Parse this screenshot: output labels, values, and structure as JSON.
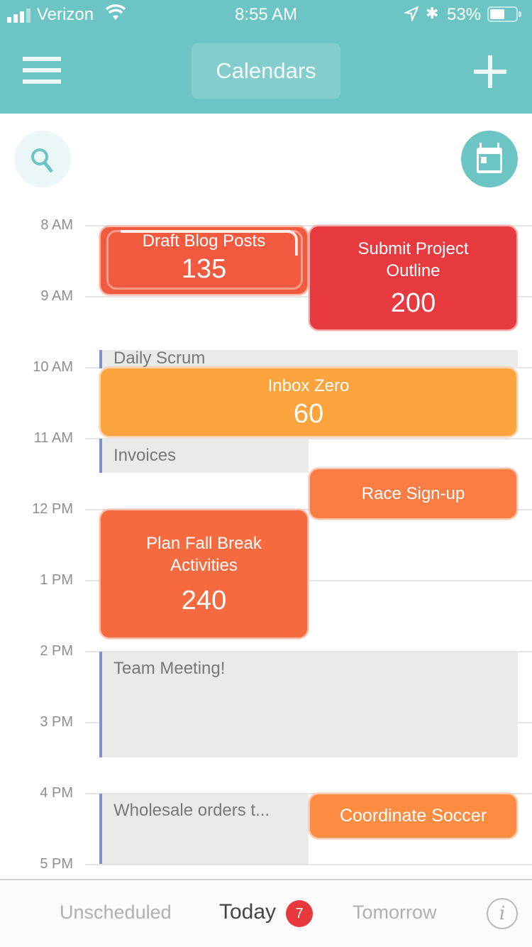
{
  "status_bar": {
    "carrier": "Verizon",
    "time": "8:55 AM",
    "battery_percent": "53%",
    "signal_bars_active": 3,
    "signal_bars_total": 4,
    "battery_level": 0.53
  },
  "header": {
    "title": "Calendars",
    "menu_icon": "hamburger-menu-icon",
    "add_icon": "plus-icon",
    "background_color": "#6cc4c4"
  },
  "toolbar": {
    "search_icon": "search-icon",
    "calendar_icon": "calendar-today-icon"
  },
  "timeline": {
    "hours": [
      "8 AM",
      "9 AM",
      "10 AM",
      "11 AM",
      "12 PM",
      "1 PM",
      "2 PM",
      "3 PM",
      "4 PM",
      "5 PM"
    ],
    "busy_blocks": [
      {
        "title": "Daily Scrum"
      },
      {
        "title": "Invoices"
      },
      {
        "title": "Team Meeting!"
      },
      {
        "title": "Wholesale orders t..."
      }
    ],
    "tasks": [
      {
        "title": "Draft Blog Posts",
        "value": "135",
        "color": "#f25a3f"
      },
      {
        "title": "Submit Project Outline",
        "value": "200",
        "color": "#e73a3e"
      },
      {
        "title": "Inbox Zero",
        "value": "60",
        "color": "#fba33d"
      },
      {
        "title": "Race Sign-up",
        "value": "",
        "color": "#f87c43"
      },
      {
        "title": "Plan Fall Break Activities",
        "value": "240",
        "color": "#f66a40"
      },
      {
        "title": "Coordinate Soccer",
        "value": "",
        "color": "#fd8c43"
      }
    ]
  },
  "bottom_tabs": {
    "unscheduled": "Unscheduled",
    "today": "Today",
    "today_badge": "7",
    "tomorrow": "Tomorrow",
    "info_icon": "info-icon",
    "info_glyph": "i",
    "active": "Today"
  }
}
